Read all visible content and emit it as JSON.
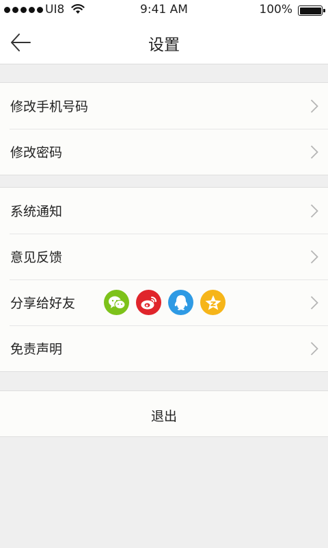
{
  "status_bar": {
    "carrier": "UI8",
    "time": "9:41 AM",
    "battery": "100%"
  },
  "header": {
    "title": "设置",
    "back_icon": "arrow-left-icon"
  },
  "account_group": {
    "items": [
      {
        "label": "修改手机号码"
      },
      {
        "label": "修改密码"
      }
    ]
  },
  "general_group": {
    "items": [
      {
        "label": "系统通知"
      },
      {
        "label": "意见反馈"
      },
      {
        "label": "分享给好友"
      },
      {
        "label": "免责声明"
      }
    ]
  },
  "share": {
    "icons": [
      {
        "name": "wechat-icon",
        "color": "#7dc21a"
      },
      {
        "name": "weibo-icon",
        "color": "#e0252b"
      },
      {
        "name": "qq-icon",
        "color": "#2e9ae4"
      },
      {
        "name": "qzone-icon",
        "color": "#f6b519"
      }
    ]
  },
  "logout": {
    "label": "退出"
  },
  "colors": {
    "background": "#efefef",
    "row_background": "#fcfcfa",
    "chevron": "#b5b5b5"
  }
}
